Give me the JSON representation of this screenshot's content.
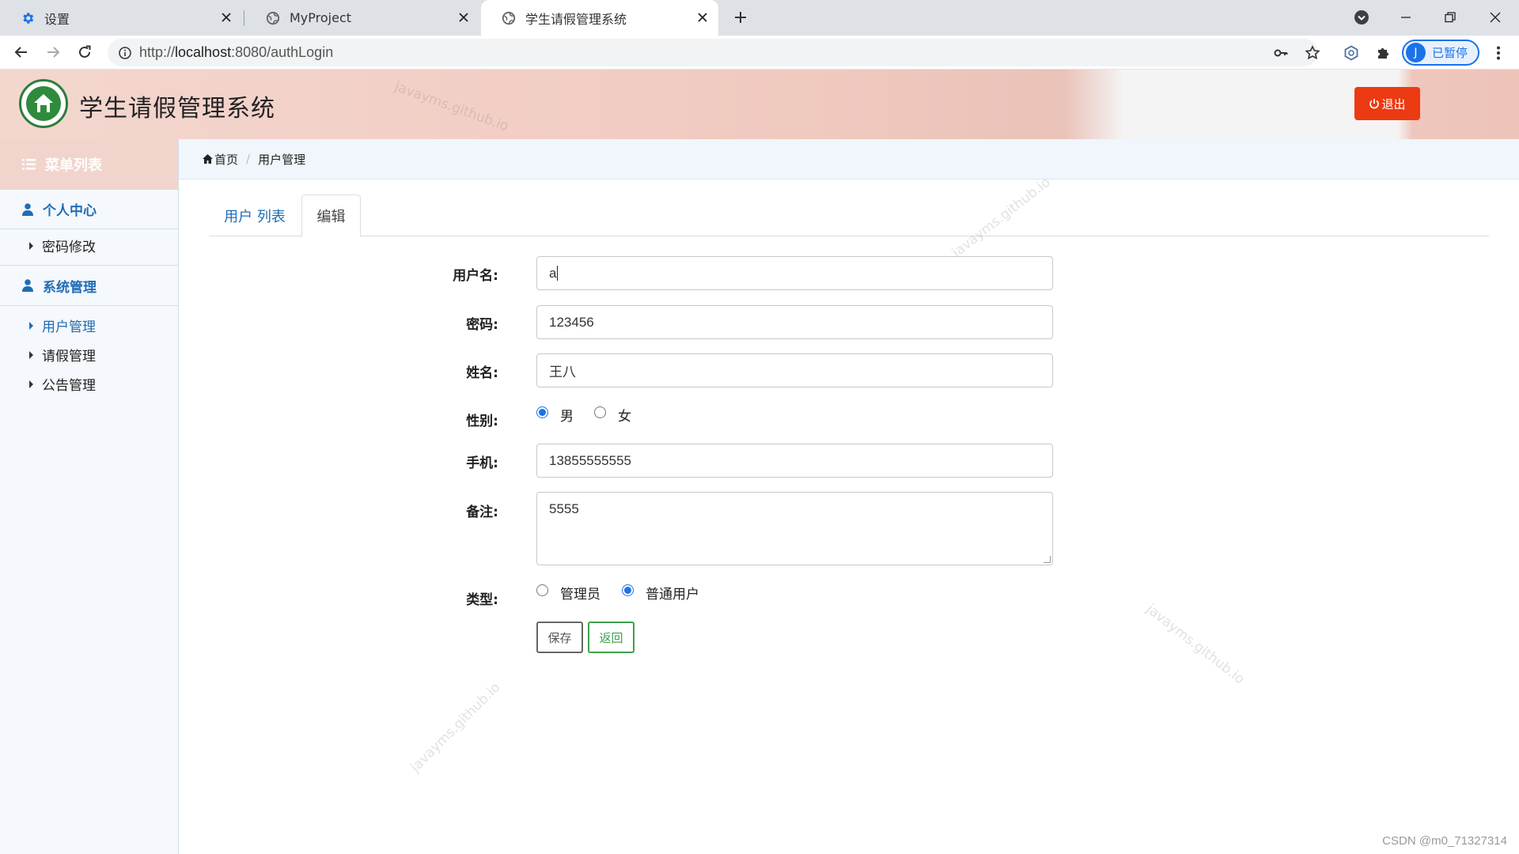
{
  "browser": {
    "tabs": [
      {
        "title": "设置",
        "icon": "gear-icon"
      },
      {
        "title": "MyProject",
        "icon": "globe-icon"
      },
      {
        "title": "学生请假管理系统",
        "icon": "globe-icon"
      }
    ],
    "url_prefix": "http://",
    "url_host": "localhost",
    "url_rest": ":8080/authLogin",
    "profile": {
      "initial": "J",
      "label": "已暂停"
    }
  },
  "app": {
    "title": "学生请假管理系统",
    "logout_label": "退出",
    "watermark": "javayms.github.io",
    "accent": "#1f6db5",
    "logout_color": "#ec3a12"
  },
  "sidebar": {
    "menu_title": "菜单列表",
    "groups": [
      {
        "label": "个人中心",
        "items": [
          {
            "label": "密码修改"
          }
        ]
      },
      {
        "label": "系统管理",
        "items": [
          {
            "label": "用户管理"
          },
          {
            "label": "请假管理"
          },
          {
            "label": "公告管理"
          }
        ]
      }
    ]
  },
  "breadcrumb": {
    "home": "首页",
    "current": "用户管理"
  },
  "page_tabs": {
    "list": "用户 列表",
    "edit": "编辑"
  },
  "form": {
    "username_label": "用户名:",
    "username_value": "a",
    "password_label": "密码:",
    "password_value": "123456",
    "name_label": "姓名:",
    "name_value": "王八",
    "gender_label": "性别:",
    "gender_male": "男",
    "gender_female": "女",
    "phone_label": "手机:",
    "phone_value": "13855555555",
    "remark_label": "备注:",
    "remark_value": "5555",
    "type_label": "类型:",
    "type_admin": "管理员",
    "type_user": "普通用户",
    "save_label": "保存",
    "back_label": "返回"
  },
  "credit": "CSDN @m0_71327314"
}
